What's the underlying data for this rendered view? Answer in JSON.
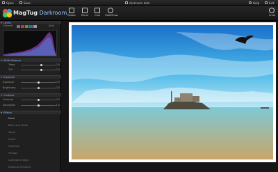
{
  "menubar": {
    "open_label": "Open",
    "save_label": "Save",
    "file_name": "darkroom beta",
    "help_label": "Help",
    "fullscreen_label": "Exit"
  },
  "toolbar": {
    "app_name_main": "MagTug",
    "app_name_sub": "Darkroom",
    "tools": [
      "Rotate",
      "Mirror",
      "Crop",
      "Hide/Show"
    ],
    "undo_label": "Undo"
  },
  "panel": {
    "levels_header": "Levels",
    "channel_label": "Channel",
    "auto_label": "Auto",
    "white_balance_header": "White Balance",
    "temp_label": "Temp",
    "temp_value": "0.5",
    "tint_label": "Tint",
    "tint_value": "0.5",
    "exposure_header": "Exposure",
    "exposure_label": "Exposure",
    "exposure_value": "0.5",
    "brightness_label": "Brightness",
    "brightness_value": "0.5",
    "contrast_header": "Contrast",
    "contrast_label": "Contrast",
    "contrast_value": "0.5",
    "saturation_label": "Saturation",
    "saturation_value": "1.0",
    "effects_header": "Effects",
    "effects": [
      "None",
      "Black and White",
      "Sepia",
      "Invert",
      "Posterize",
      "Vintage",
      "Lightroom Edges",
      "Exposure Enhance"
    ]
  },
  "slider_levels": {
    "temp": 0.58,
    "tint": 0.58,
    "exposure": 0.5,
    "brightness": 0.5,
    "contrast": 0.5,
    "saturation": 0.5
  }
}
